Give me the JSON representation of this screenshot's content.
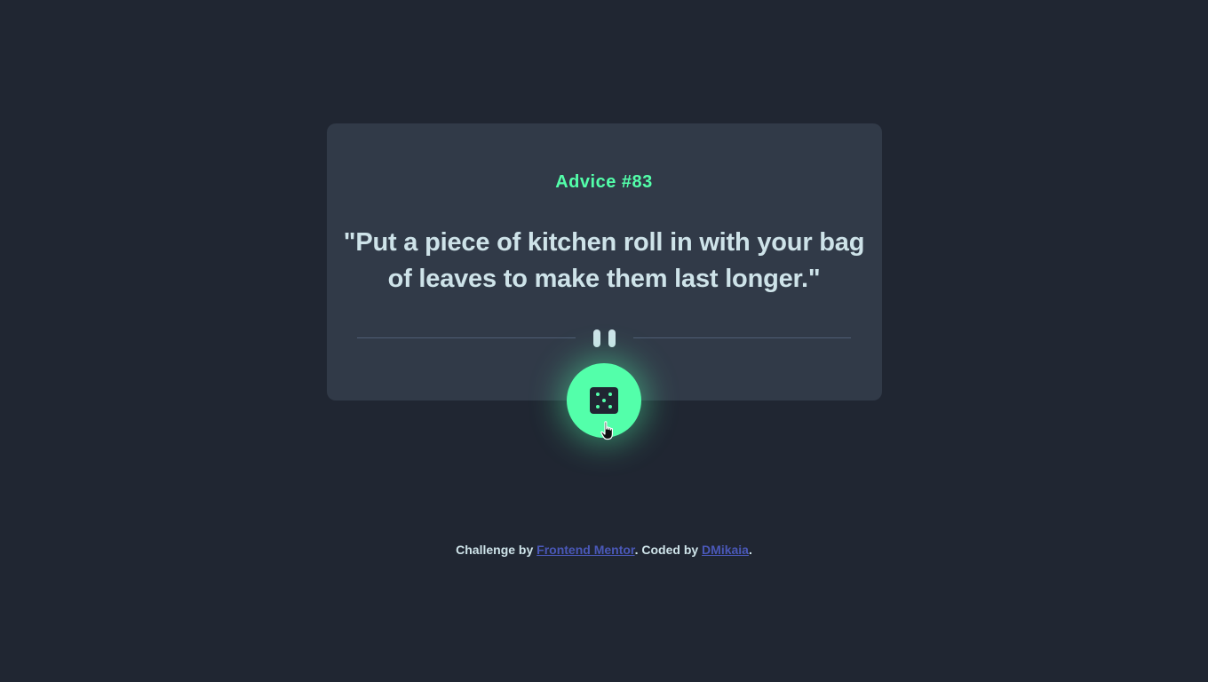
{
  "advice": {
    "id_label": "Advice #83",
    "quote": "\"Put a piece of kitchen roll in with your bag of leaves to make them last longer.\""
  },
  "divider": {
    "icon": "pause-icon"
  },
  "button": {
    "icon": "dice-icon"
  },
  "footer": {
    "prefix": "Challenge by ",
    "link1": "Frontend Mentor",
    "middle": ". Coded by ",
    "link2": "DMikaia",
    "suffix": "."
  },
  "colors": {
    "background": "#202632",
    "card": "#313A48",
    "accent": "#53FFAA",
    "text": "#CEE3E9",
    "divider": "#4F5D74",
    "link": "#4A58B8"
  }
}
